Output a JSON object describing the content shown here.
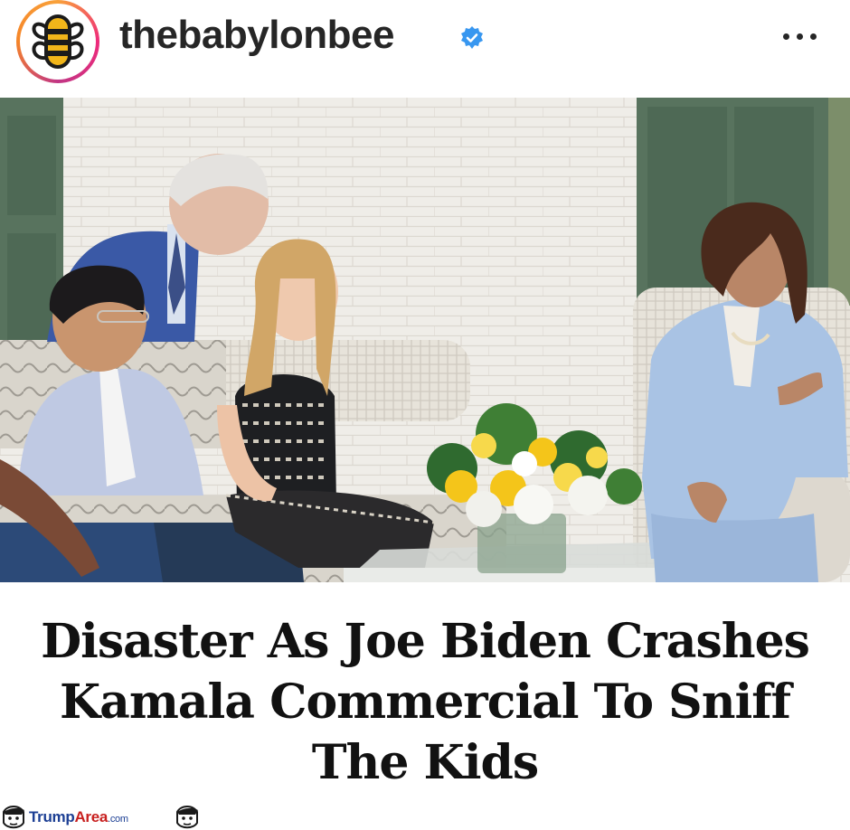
{
  "post": {
    "username": "thebabylonbee",
    "verified_icon": "verified-badge-icon",
    "more_icon": "more-options-icon",
    "headline": "Disaster As Joe Biden Crashes Kamala Commercial To Sniff The Kids"
  },
  "colors": {
    "username": "#262626",
    "verified": "#3897f0",
    "headline": "#111111",
    "watermark_blue": "#1c3f94",
    "watermark_red": "#c8201f"
  },
  "watermark": {
    "part1": "Trump",
    "part2": "Area",
    "part3": ".com"
  }
}
